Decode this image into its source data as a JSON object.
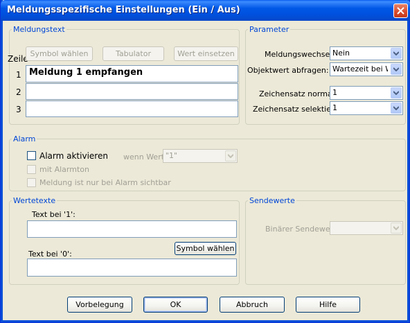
{
  "window": {
    "title": "Meldungsspezifische Einstellungen (Ein / Aus)"
  },
  "meldungstext": {
    "legend": "Meldungstext",
    "zeile_label": "Zeile",
    "buttons": {
      "symbol": "Symbol wählen",
      "tabulator": "Tabulator",
      "wert": "Wert einsetzen"
    },
    "rows": [
      {
        "num": "1",
        "value": "Meldung 1 empfangen"
      },
      {
        "num": "2",
        "value": ""
      },
      {
        "num": "3",
        "value": ""
      }
    ]
  },
  "parameter": {
    "legend": "Parameter",
    "meldungswechsel": {
      "label": "Meldungswechsel:",
      "value": "Nein"
    },
    "objektwert": {
      "label": "Objektwert abfragen:",
      "value": "Wartezeit bei Wi"
    },
    "zeichensatz_normal": {
      "label": "Zeichensatz normal:",
      "value": "1"
    },
    "zeichensatz_selektiert": {
      "label": "Zeichensatz selektiert:",
      "value": "1"
    }
  },
  "alarm": {
    "legend": "Alarm",
    "aktivieren_label": "Alarm aktivieren",
    "wenn_wert_label": "wenn Wert:",
    "wenn_wert_value": "\"1\"",
    "alarmton_label": "mit Alarmton",
    "sichtbar_label": "Meldung ist nur bei Alarm sichtbar"
  },
  "wertetexte": {
    "legend": "Wertetexte",
    "text1_label": "Text bei '1':",
    "text1_value": "",
    "text0_label": "Text bei '0':",
    "text0_value": "",
    "symbol_button": "Symbol wählen"
  },
  "sendewerte": {
    "legend": "Sendewerte",
    "binaer_label": "Binärer Sendewert:",
    "binaer_value": ""
  },
  "footer": {
    "vorbelegung": "Vorbelegung",
    "ok": "OK",
    "abbruch": "Abbruch",
    "hilfe": "Hilfe"
  },
  "colors": {
    "accent": "#0046d5",
    "titlebar": "#0058e6",
    "close": "#d8492a"
  }
}
